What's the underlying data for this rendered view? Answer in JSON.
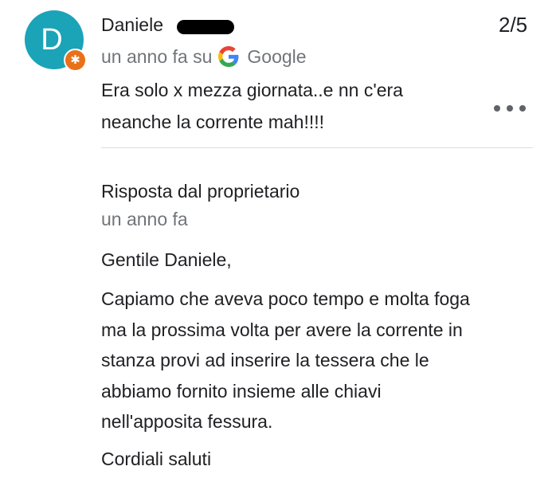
{
  "review": {
    "avatar_letter": "D",
    "avatar_color": "#1ba3b8",
    "badge_color": "#e8711a",
    "badge_icon": "local-guide-star-icon",
    "reviewer_name": "Daniele",
    "rating": "2/5",
    "time": "un anno fa su",
    "source": "Google",
    "text_lines": [
      "Era solo x mezza giornata..e nn c'era",
      "neanche la corrente mah!!!!"
    ],
    "more_icon": "more-options-icon"
  },
  "owner_response": {
    "title": "Risposta dal proprietario",
    "time": "un anno fa",
    "greeting": "Gentile Daniele,",
    "body_lines": [
      "Capiamo che aveva poco tempo e molta foga",
      "ma la prossima volta per avere la corrente in",
      "stanza provi ad inserire la tessera che le",
      "abbiamo fornito insieme alle chiavi",
      "nell'apposita fessura."
    ],
    "closing": "Cordiali saluti"
  }
}
